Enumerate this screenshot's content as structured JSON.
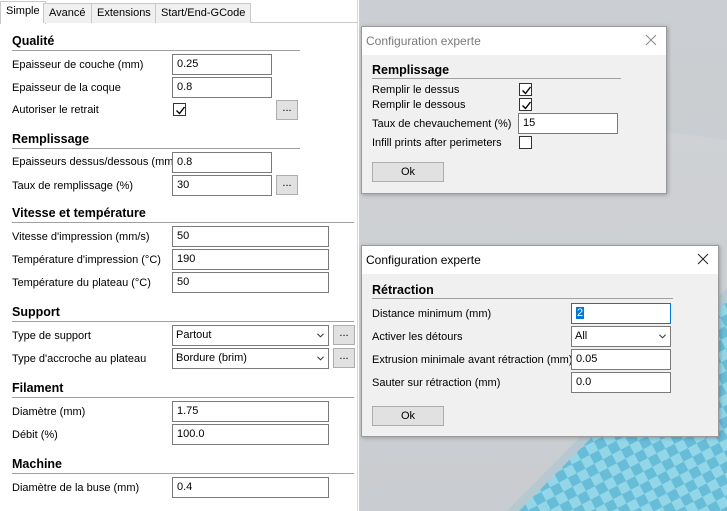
{
  "tabs": [
    "Simple",
    "Avancé",
    "Extensions",
    "Start/End-GCode"
  ],
  "sections": {
    "quality": {
      "title": "Qualité",
      "layer_height": {
        "label": "Epaisseur de couche (mm)",
        "value": "0.25"
      },
      "shell_thickness": {
        "label": "Epaisseur de la coque",
        "value": "0.8"
      },
      "retraction": {
        "label": "Autoriser le retrait",
        "checked": true
      }
    },
    "fill": {
      "title": "Remplissage",
      "top_bottom": {
        "label": "Epaisseurs dessus/dessous (mm)",
        "value": "0.8"
      },
      "density": {
        "label": "Taux de remplissage (%)",
        "value": "30"
      }
    },
    "speed": {
      "title": "Vitesse et température",
      "print_speed": {
        "label": "Vitesse d'impression (mm/s)",
        "value": "50"
      },
      "print_temp": {
        "label": "Température d'impression (°C)",
        "value": "190"
      },
      "bed_temp": {
        "label": "Température du plateau (°C)",
        "value": "50"
      }
    },
    "support": {
      "title": "Support",
      "type": {
        "label": "Type de support",
        "value": "Partout"
      },
      "adhesion": {
        "label": "Type d'accroche au plateau",
        "value": "Bordure (brim)"
      }
    },
    "filament": {
      "title": "Filament",
      "diameter": {
        "label": "Diamètre (mm)",
        "value": "1.75"
      },
      "flow": {
        "label": "Débit (%)",
        "value": "100.0"
      }
    },
    "machine": {
      "title": "Machine",
      "nozzle": {
        "label": "Diamètre de la buse (mm)",
        "value": "0.4"
      }
    }
  },
  "more_button": "...",
  "dialog_fill": {
    "title": "Configuration experte",
    "section": "Remplissage",
    "top": {
      "label": "Remplir le dessus",
      "checked": true
    },
    "bottom": {
      "label": "Remplir le dessous",
      "checked": true
    },
    "overlap": {
      "label": "Taux de chevauchement (%)",
      "value": "15"
    },
    "infill_after": {
      "label": "Infill prints after perimeters",
      "checked": false
    },
    "ok": "Ok"
  },
  "dialog_retraction": {
    "title": "Configuration experte",
    "section": "Rétraction",
    "min_distance": {
      "label": "Distance minimum (mm)",
      "value": "2"
    },
    "combing": {
      "label": "Activer les détours",
      "value": "All"
    },
    "min_extrusion": {
      "label": "Extrusion minimale avant rétraction (mm)",
      "value": "0.05"
    },
    "z_hop": {
      "label": "Sauter sur rétraction (mm)",
      "value": "0.0"
    },
    "ok": "Ok"
  },
  "colors": {
    "accent_focus": "#0078d7",
    "viewport_sky": "#d3d5d8",
    "build_plate_light": "#8fd3e6",
    "build_plate_dark": "#5fb7d3"
  }
}
